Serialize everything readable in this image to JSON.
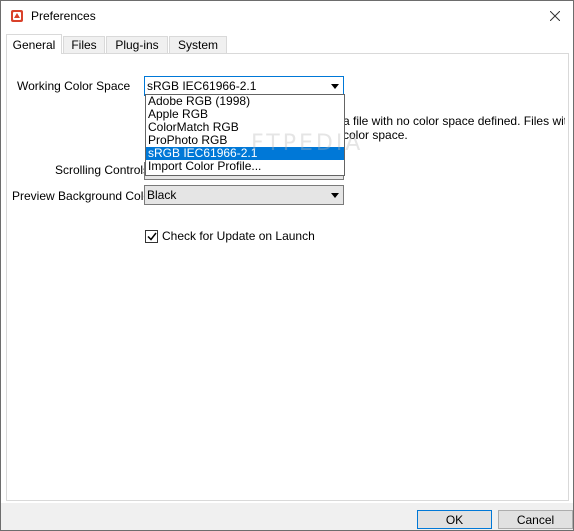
{
  "window": {
    "title": "Preferences"
  },
  "tabs": [
    {
      "label": "General",
      "active": true
    },
    {
      "label": "Files",
      "active": false
    },
    {
      "label": "Plug-ins",
      "active": false
    },
    {
      "label": "System",
      "active": false
    }
  ],
  "general": {
    "working_color_space": {
      "label": "Working Color Space",
      "value": "sRGB IEC61966-2.1",
      "options": [
        "Adobe RGB (1998)",
        "Apple RGB",
        "ColorMatch RGB",
        "ProPhoto RGB",
        "sRGB IEC61966-2.1",
        "Import Color Profile..."
      ],
      "selected_index": 4
    },
    "description_line1": "a file with no color space defined. Files with",
    "description_line2": "color space.",
    "scrolling_controls": {
      "label": "Scrolling Controls"
    },
    "preview_background": {
      "label": "Preview Background Color",
      "value": "Black"
    },
    "check_update": {
      "label": "Check for Update on Launch",
      "checked": true
    }
  },
  "watermark": "FTPEDIA",
  "buttons": {
    "ok": "OK",
    "cancel": "Cancel"
  },
  "colors": {
    "accent": "#0078d7",
    "footer_bg": "#f0f0f0",
    "app_icon": "#d9412a"
  }
}
